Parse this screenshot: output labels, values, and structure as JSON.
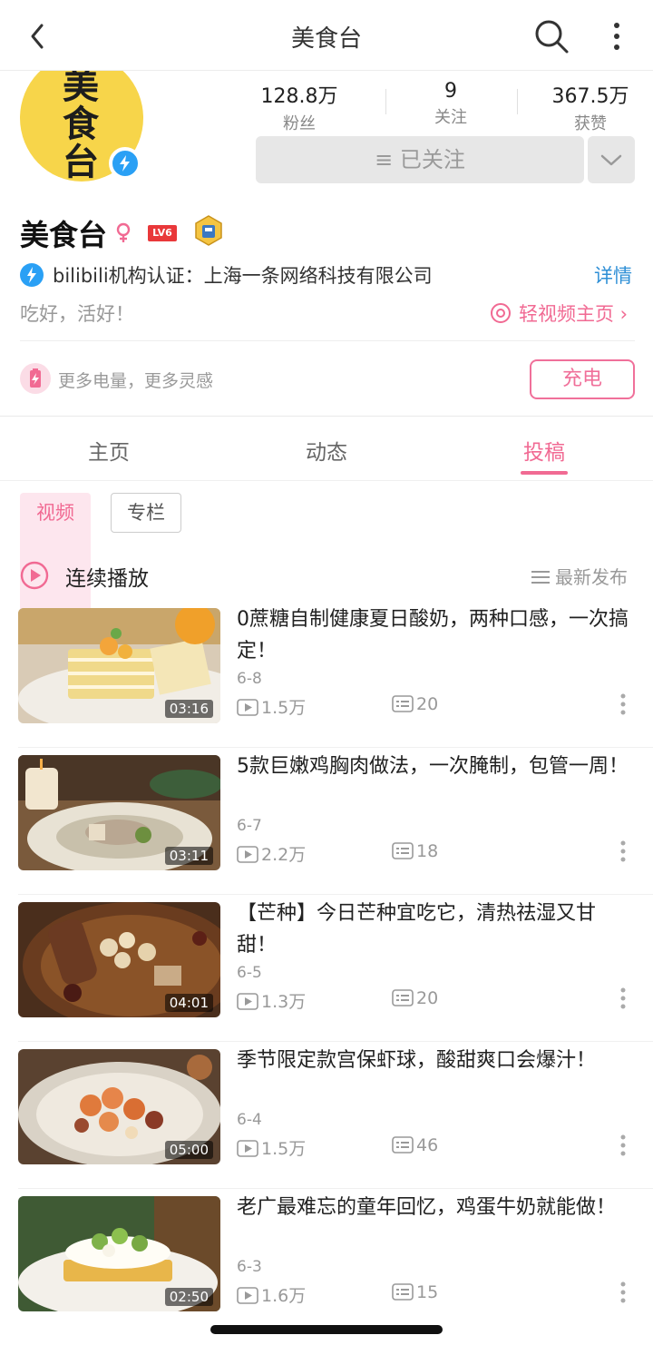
{
  "nav": {
    "title": "美食台"
  },
  "profile": {
    "logo_text": "美\n食\n台",
    "name": "美食台",
    "level": "LV6",
    "stats": [
      {
        "value": "128.8万",
        "label": "粉丝"
      },
      {
        "value": "9",
        "label": "关注"
      },
      {
        "value": "367.5万",
        "label": "获赞"
      }
    ],
    "follow_label": "≡ 已关注",
    "cert_text": "bilibili机构认证：上海一条网络科技有限公司",
    "detail_label": "详情",
    "bio": "吃好，活好！",
    "light_video_label": "轻视频主页 ›",
    "charge_text": "更多电量，更多灵感",
    "charge_label": "充电"
  },
  "tabs": [
    {
      "label": "主页"
    },
    {
      "label": "动态"
    },
    {
      "label": "投稿",
      "active": true
    }
  ],
  "chips": {
    "video": "视频",
    "column": "专栏"
  },
  "list": {
    "play_all": "连续播放",
    "sort": "最新发布"
  },
  "videos": [
    {
      "title": "0蔗糖自制健康夏日酸奶，两种口感，一次搞定！",
      "date": "6-8",
      "plays": "1.5万",
      "danmaku": "20",
      "duration": "03:16"
    },
    {
      "title": "5款巨嫩鸡胸肉做法，一次腌制，包管一周！",
      "date": "6-7",
      "plays": "2.2万",
      "danmaku": "18",
      "duration": "03:11"
    },
    {
      "title": "【芒种】今日芒种宜吃它，清热祛湿又甘甜！",
      "date": "6-5",
      "plays": "1.3万",
      "danmaku": "20",
      "duration": "04:01"
    },
    {
      "title": "季节限定款宫保虾球，酸甜爽口会爆汁！",
      "date": "6-4",
      "plays": "1.5万",
      "danmaku": "46",
      "duration": "05:00"
    },
    {
      "title": "老广最难忘的童年回忆，鸡蛋牛奶就能做！",
      "date": "6-3",
      "plays": "1.6万",
      "danmaku": "15",
      "duration": "02:50"
    }
  ],
  "colors": {
    "accent": "#f16a93",
    "link": "#2e8fd6",
    "verify": "#2aa0f5",
    "avatar_bg": "#f7d54a"
  }
}
